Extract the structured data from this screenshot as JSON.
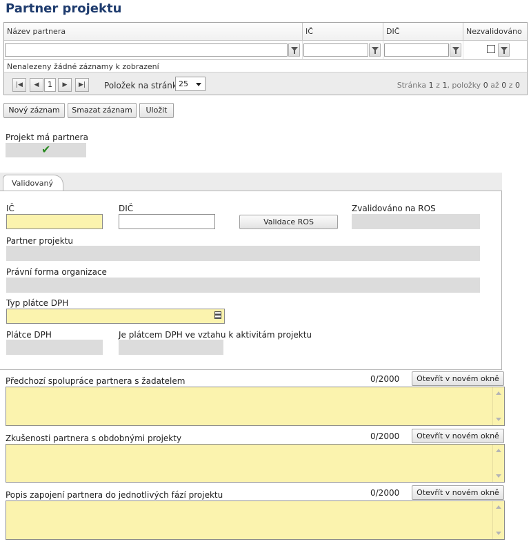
{
  "page": {
    "title": "Partner projektu"
  },
  "grid": {
    "columns": [
      "Název partnera",
      "IČ",
      "DIČ",
      "Nezvalidováno"
    ],
    "empty_message": "Nenalezeny žádné záznamy k zobrazení",
    "pager": {
      "current_page": "1",
      "page_size_label": "Položek na stránku",
      "page_size": "25",
      "info": {
        "prefix": "Stránka",
        "page": "1",
        "of_word": "z",
        "total_pages": "1",
        "items_word": ", položky",
        "from": "0",
        "to_word": "až",
        "to": "0",
        "of2_word": "z",
        "total": "0"
      }
    }
  },
  "toolbar": {
    "new_label": "Nový záznam",
    "delete_label": "Smazat záznam",
    "save_label": "Uložit"
  },
  "has_partner": {
    "label": "Projekt má partnera",
    "checked": true
  },
  "tabs": [
    "Validovaný"
  ],
  "form": {
    "ic_label": "IČ",
    "dic_label": "DIČ",
    "validate_button": "Validace ROS",
    "validated_label": "Zvalidováno na ROS",
    "partner_label": "Partner projektu",
    "legal_form_label": "Právní forma organizace",
    "vat_type_label": "Typ plátce DPH",
    "vat_payer_label": "Plátce DPH",
    "vat_activity_label": "Je plátcem DPH ve vztahu k aktivitám projektu"
  },
  "textareas": [
    {
      "label": "Předchozí spolupráce partnera s žadatelem",
      "counter": "0/2000",
      "open_button": "Otevřít v novém okně"
    },
    {
      "label": "Zkušenosti partnera s obdobnými projekty",
      "counter": "0/2000",
      "open_button": "Otevřít v novém okně"
    },
    {
      "label": "Popis zapojení partnera do jednotlivých fází projektu",
      "counter": "0/2000",
      "open_button": "Otevřít v novém okně"
    }
  ],
  "colors": {
    "title": "#1f3c6e",
    "required_field": "#fbf3ae",
    "readonly_field": "#dcdcdc",
    "check": "#2a8a22"
  }
}
